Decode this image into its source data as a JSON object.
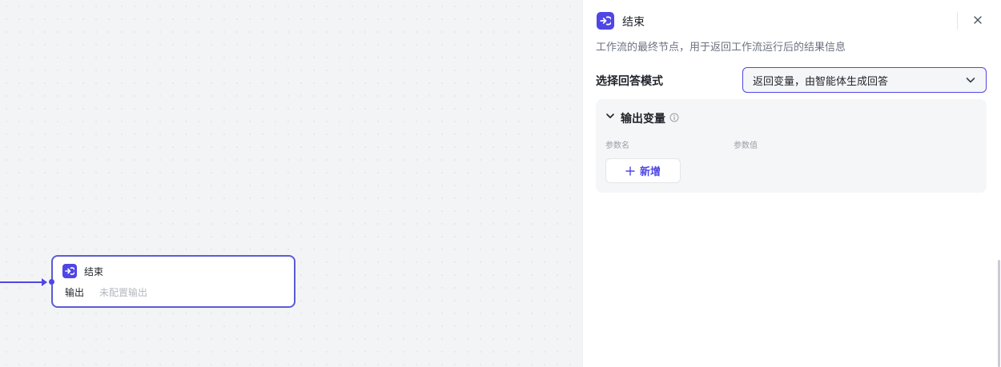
{
  "canvas": {
    "node": {
      "title": "结束",
      "output_label": "输出",
      "output_value": "未配置输出"
    }
  },
  "panel": {
    "title": "结束",
    "description": "工作流的最终节点，用于返回工作流运行后的结果信息",
    "mode": {
      "label": "选择回答模式",
      "selected": "返回变量，由智能体生成回答"
    },
    "output_section": {
      "title": "输出变量",
      "columns": [
        "参数名",
        "参数值"
      ],
      "add_label": "新增"
    }
  },
  "colors": {
    "accent": "#4f46e5",
    "canvas_bg": "#f3f4f6",
    "muted_text": "#b4b8bf"
  }
}
